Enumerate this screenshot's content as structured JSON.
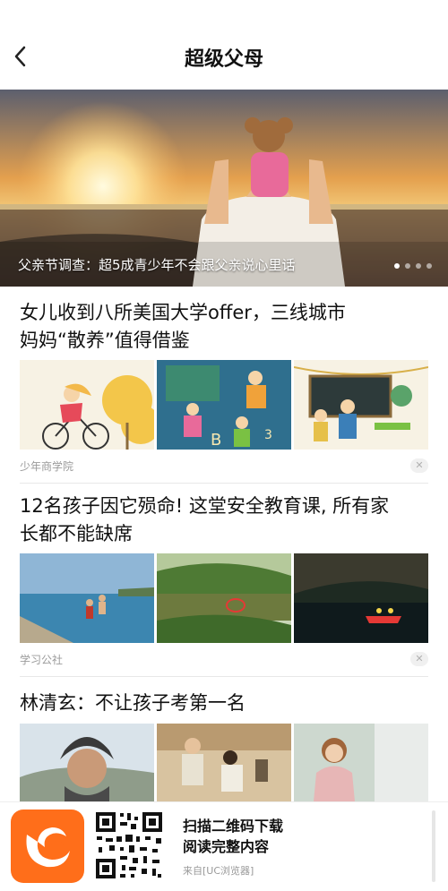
{
  "header": {
    "title": "超级父母"
  },
  "banner": {
    "caption": "父亲节调查：超5成青少年不会跟父亲说心里话",
    "slide_count": 4,
    "active_index": 0
  },
  "articles": [
    {
      "title_line1": "女儿收到八所美国大学offer，三线城市",
      "title_line2": "妈妈“散养”值得借鉴",
      "source": "少年商学院",
      "dismiss": "✕"
    },
    {
      "title_line1": "12名孩子因它殒命! 这堂安全教育课, 所有家",
      "title_line2": "长都不能缺席",
      "source": "学习公社",
      "dismiss": "✕"
    },
    {
      "title_line1": "林清玄：不让孩子考第一名",
      "title_line2": ""
    }
  ],
  "footer": {
    "line1": "扫描二维码下载",
    "line2": "阅读完整内容",
    "source": "来自[UC浏览器]",
    "brand_color": "#ff6e1a"
  },
  "colors": {
    "accent": "#ff6e1a",
    "meta_text": "#9a9a9a"
  }
}
